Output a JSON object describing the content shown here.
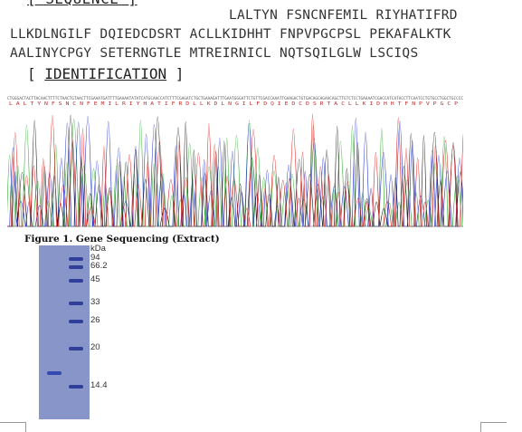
{
  "sequence_section": {
    "header_partial": "[ SEQUENCE ]",
    "lines": [
      "LALTYN FSNCNFEMIL RIYHATIFRD",
      "LLKDLNGILF DQIEDCDSRT ACLLKIDHHT FNPVPGCPSL PEKAFALKTK",
      "AALINYCPGY SETERNGTLE MTREIRNICL NQTSQILGLW LSCIQS"
    ]
  },
  "identification": {
    "bracket_open": "[",
    "title": "IDENTIFICATION",
    "bracket_close": "]"
  },
  "chromatogram": {
    "base_calls": "CTGGGACTACTTACAACTTTTCTAACTGTAACTTCGAAATGATTTTGAAAATATATCATGCAACCATCTTTCGAGATCTGCTGAAAGATTTGAATGGGATTCTGTTCGACCAAATTGAAGACTGTGACAGCAGAACAGCTTGTCTCCTGAAAATCGACCATCATACCTTCAATCCTGTGCCTGGCTGCCCC",
    "amino_acids": "L A L T Y N F S N C N F E M I L R I Y H A T I F R D L L K D L N G I L F D Q I E D C D S R T A C L L K I D H H T F N P V P G C P",
    "trace_colors": {
      "A": "#3ab03a",
      "C": "#2a3ad0",
      "G": "#222222",
      "T": "#e02020"
    }
  },
  "figure_caption": "Figure 1. Gene Sequencing (Extract)",
  "gel": {
    "unit_label": "kDa",
    "markers": [
      {
        "label": "94",
        "pos": 0.07
      },
      {
        "label": "66.2",
        "pos": 0.115
      },
      {
        "label": "45",
        "pos": 0.195
      },
      {
        "label": "33",
        "pos": 0.325
      },
      {
        "label": "26",
        "pos": 0.425
      },
      {
        "label": "20",
        "pos": 0.585
      },
      {
        "label": "14.4",
        "pos": 0.8
      }
    ],
    "sample_band_pos": 0.725,
    "gel_color": "#8795c8",
    "band_color": "#2f3f9a"
  }
}
